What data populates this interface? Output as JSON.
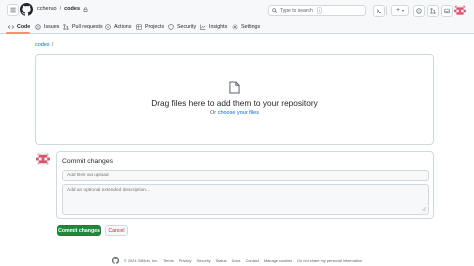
{
  "header": {
    "owner": "ccheruo",
    "repo": "codes",
    "search_placeholder": "Type to search",
    "search_shortcut": "/",
    "new_button": "+"
  },
  "nav": {
    "tabs": [
      {
        "label": "Code",
        "icon": "code-icon",
        "active": true
      },
      {
        "label": "Issues",
        "icon": "issue-icon"
      },
      {
        "label": "Pull requests",
        "icon": "pull-request-icon"
      },
      {
        "label": "Actions",
        "icon": "actions-play-icon"
      },
      {
        "label": "Projects",
        "icon": "projects-table-icon"
      },
      {
        "label": "Security",
        "icon": "shield-icon"
      },
      {
        "label": "Insights",
        "icon": "graph-icon"
      },
      {
        "label": "Settings",
        "icon": "gear-icon"
      }
    ]
  },
  "breadcrumb": {
    "repo": "codes",
    "separator": "/"
  },
  "upload": {
    "drag_text": "Drag files here to add them to your repository",
    "or_text": "Or",
    "choose_link": "choose your files"
  },
  "commit": {
    "title": "Commit changes",
    "summary_placeholder": "Add files via upload",
    "description_placeholder": "Add an optional extended description...",
    "commit_button": "Commit changes",
    "cancel_button": "Cancel"
  },
  "footer": {
    "copyright": "© 2024 GitHub, Inc.",
    "links": [
      "Terms",
      "Privacy",
      "Security",
      "Status",
      "Docs",
      "Contact",
      "Manage cookies",
      "Do not share my personal information"
    ]
  },
  "colors": {
    "primary_green": "#1f883d",
    "link_blue": "#0969da",
    "danger_red": "#d1242f",
    "active_tab_underline": "#fd8c73",
    "border": "#d1d9e0",
    "canvas_subtle": "#f6f8fa"
  }
}
